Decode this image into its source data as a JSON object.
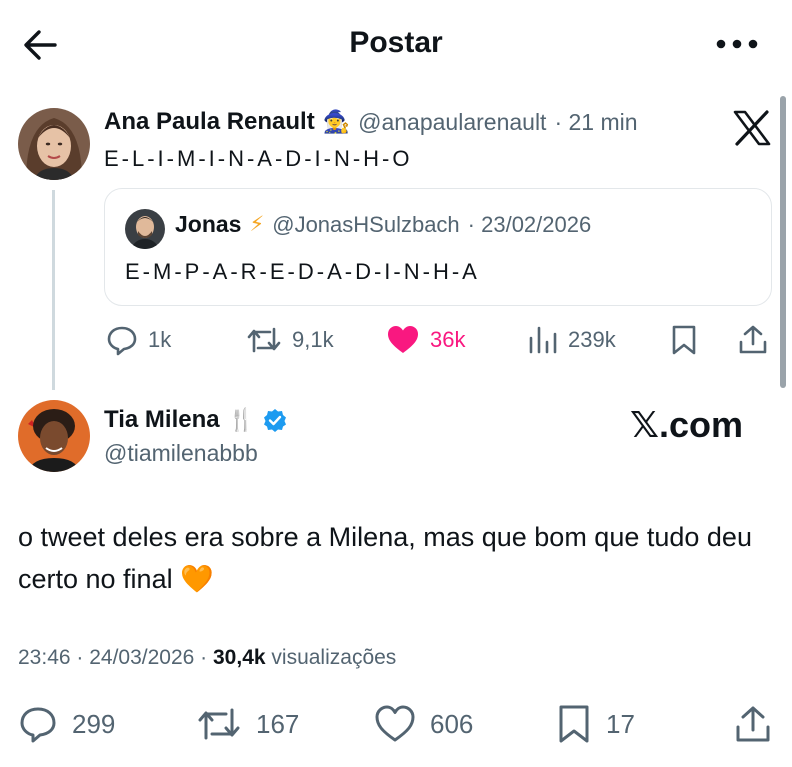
{
  "header": {
    "title": "Postar",
    "back_icon": "arrow-left-icon",
    "more_icon": "more-horizontal-icon"
  },
  "quoted_post": {
    "author_name": "Ana Paula Renault",
    "author_emoji": "🧙‍♀️",
    "author_handle": "@anapaularenault",
    "time": "· 21 min",
    "text": "E-L-I-M-I-N-A-D-I-N-H-O",
    "inner_quote": {
      "author_name": "Jonas",
      "author_emoji": "⚡",
      "author_handle": "@JonasHSulzbach",
      "date": "· 23/02/2026",
      "text": "E-M-P-A-R-E-D-A-D-I-N-H-A"
    },
    "actions": {
      "replies": "1k",
      "reposts": "9,1k",
      "likes": "36k",
      "views": "239k"
    },
    "colors": {
      "liked": "#f91880"
    }
  },
  "main_post": {
    "author_name": "Tia Milena",
    "author_emoji": "🍴",
    "author_handle": "@tiamilenabbb",
    "watermark": "𝕏.com",
    "text": "o tweet deles era sobre a Milena, mas que bom que tudo deu certo no final 🧡",
    "time": "23:46 · 24/03/2026 ·",
    "views_count": "30,4k",
    "views_label": "visualizações",
    "actions": {
      "replies": "299",
      "reposts": "167",
      "likes": "606",
      "bookmarks": "17"
    },
    "colors": {
      "verified": "#1d9bf0"
    }
  }
}
